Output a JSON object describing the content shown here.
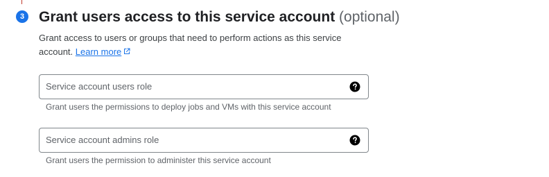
{
  "step": {
    "number": "3",
    "title": "Grant users access to this service account",
    "title_optional": "(optional)",
    "description": "Grant access to users or groups that need to perform actions as this service account.",
    "learn_more": "Learn more"
  },
  "fields": [
    {
      "label": "Service account users role",
      "hint": "Grant users the permissions to deploy jobs and VMs with this service account",
      "icon": "help-icon"
    },
    {
      "label": "Service account admins role",
      "hint": "Grant users the permission to administer this service account",
      "icon": "help-icon"
    }
  ],
  "colors": {
    "accent": "#1a73e8",
    "text": "#202124",
    "secondary_text": "#5f6368",
    "border": "#80868b"
  }
}
